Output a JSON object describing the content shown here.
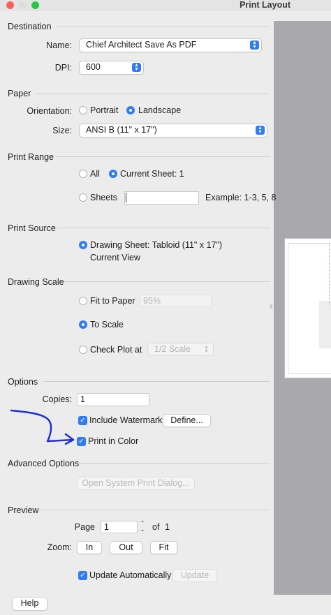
{
  "window": {
    "title": "Print Layout"
  },
  "destination": {
    "heading": "Destination",
    "name_label": "Name:",
    "name_value": "Chief Architect Save As PDF",
    "dpi_label": "DPI:",
    "dpi_value": "600"
  },
  "paper": {
    "heading": "Paper",
    "orientation_label": "Orientation:",
    "portrait": "Portrait",
    "landscape": "Landscape",
    "selected": "Landscape",
    "size_label": "Size:",
    "size_value": "ANSI B  (11\" x 17\")"
  },
  "print_range": {
    "heading": "Print Range",
    "all": "All",
    "current_sheet": "Current Sheet: 1",
    "sheets": "Sheets",
    "sheets_value": "",
    "example": "Example: 1-3, 5, 8",
    "selected": "Current Sheet: 1"
  },
  "print_source": {
    "heading": "Print Source",
    "drawing_sheet": "Drawing Sheet: Tabloid  (11\" x 17\")",
    "current_view": "Current View",
    "selected": "Drawing Sheet"
  },
  "drawing_scale": {
    "heading": "Drawing Scale",
    "fit_to_paper": "Fit to Paper",
    "fit_value": "95%",
    "to_scale": "To Scale",
    "check_plot": "Check Plot at",
    "check_plot_value": "1/2 Scale",
    "selected": "To Scale"
  },
  "options": {
    "heading": "Options",
    "copies_label": "Copies:",
    "copies_value": "1",
    "include_watermark": "Include Watermark",
    "define_button": "Define...",
    "print_in_color": "Print in Color"
  },
  "advanced": {
    "heading": "Advanced Options",
    "system_dialog_button": "Open System Print Dialog..."
  },
  "preview": {
    "heading": "Preview",
    "page_label": "Page",
    "page_value": "1",
    "of_label": "of",
    "page_total": "1",
    "zoom_label": "Zoom:",
    "zoom_in": "In",
    "zoom_out": "Out",
    "zoom_fit": "Fit",
    "update_automatically": "Update Automatically",
    "update_button": "Update"
  },
  "footer": {
    "help_button": "Help"
  },
  "icons": {
    "checkbox_checked": "checkmark",
    "popup_arrows": "up-down-chevron",
    "annotation": "hand-drawn-arrow"
  },
  "colors": {
    "accent": "#2f7cf6",
    "annotation": "#1f2fd6"
  }
}
